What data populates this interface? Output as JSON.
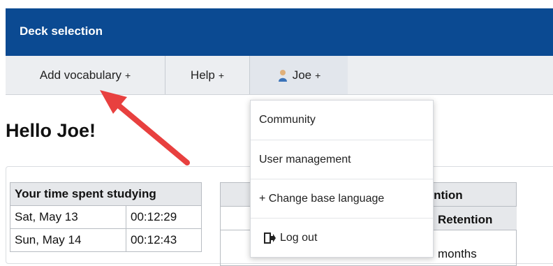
{
  "header": {
    "title": "Deck selection",
    "bg_color": "#0b4a92"
  },
  "nav": {
    "items": [
      {
        "label": "Add vocabulary",
        "suffix": "+"
      },
      {
        "label": "Help",
        "suffix": "+"
      },
      {
        "label": "Joe",
        "suffix": "+",
        "icon": "user-icon"
      }
    ]
  },
  "greeting": "Hello Joe!",
  "dropdown": {
    "items": [
      {
        "label": "Community"
      },
      {
        "label": "User management"
      },
      {
        "label": "+ Change base language"
      },
      {
        "label": "Log out",
        "icon": "logout-icon"
      }
    ]
  },
  "study_table": {
    "header": "Your time spent studying",
    "rows": [
      {
        "date": "Sat, May 13",
        "time": "00:12:29"
      },
      {
        "date": "Sun, May 14",
        "time": "00:12:43"
      }
    ]
  },
  "retention_table": {
    "header": "tention",
    "subheader": "Retention",
    "partial_value": "months"
  },
  "annotation": {
    "arrow_color": "#e8403f"
  }
}
